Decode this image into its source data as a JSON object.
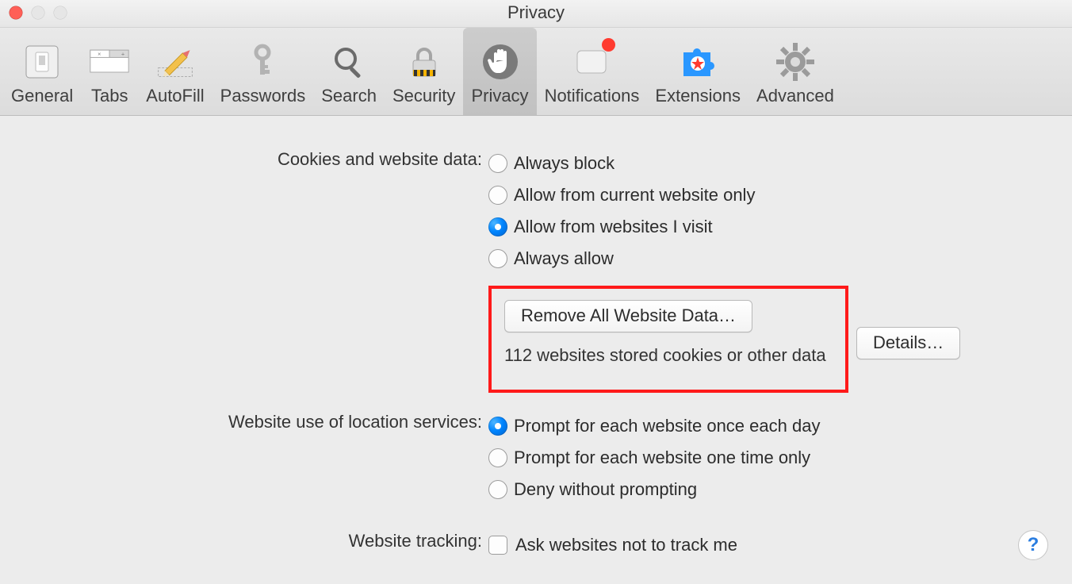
{
  "window": {
    "title": "Privacy"
  },
  "toolbar": {
    "items": [
      {
        "id": "general",
        "label": "General"
      },
      {
        "id": "tabs",
        "label": "Tabs"
      },
      {
        "id": "autofill",
        "label": "AutoFill"
      },
      {
        "id": "passwords",
        "label": "Passwords"
      },
      {
        "id": "search",
        "label": "Search"
      },
      {
        "id": "security",
        "label": "Security"
      },
      {
        "id": "privacy",
        "label": "Privacy",
        "selected": true
      },
      {
        "id": "notifications",
        "label": "Notifications",
        "badge": true
      },
      {
        "id": "extensions",
        "label": "Extensions"
      },
      {
        "id": "advanced",
        "label": "Advanced"
      }
    ]
  },
  "sections": {
    "cookies": {
      "label": "Cookies and website data:",
      "options": [
        {
          "label": "Always block",
          "selected": false
        },
        {
          "label": "Allow from current website only",
          "selected": false
        },
        {
          "label": "Allow from websites I visit",
          "selected": true
        },
        {
          "label": "Always allow",
          "selected": false
        }
      ],
      "remove_button": "Remove All Website Data…",
      "status": "112 websites stored cookies or other data",
      "details_button": "Details…"
    },
    "location": {
      "label": "Website use of location services:",
      "options": [
        {
          "label": "Prompt for each website once each day",
          "selected": true
        },
        {
          "label": "Prompt for each website one time only",
          "selected": false
        },
        {
          "label": "Deny without prompting",
          "selected": false
        }
      ]
    },
    "tracking": {
      "label": "Website tracking:",
      "checkbox_label": "Ask websites not to track me",
      "checked": false
    }
  },
  "help_label": "?"
}
